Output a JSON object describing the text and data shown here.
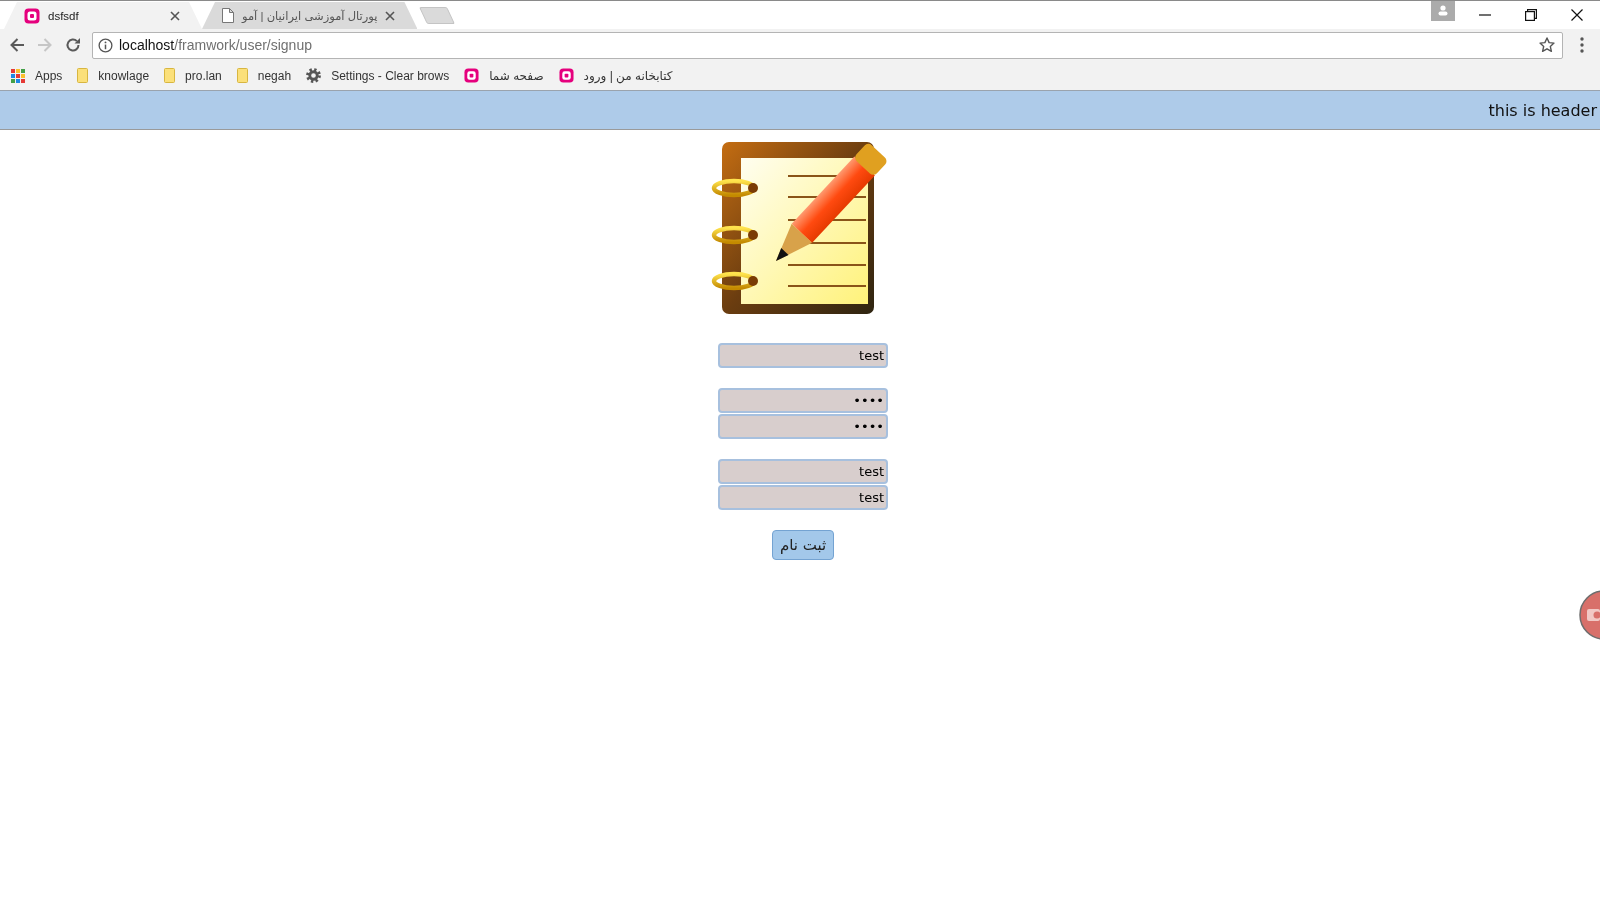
{
  "browser": {
    "tabs": [
      {
        "title": "dsfsdf",
        "kind": "logo",
        "selected": true
      },
      {
        "title": "پورتال آموزشی ایرانیان | آمو",
        "kind": "document",
        "selected": false
      }
    ],
    "navigation": [
      {
        "kind": "back",
        "disabled": false
      },
      {
        "kind": "forward",
        "disabled": true
      },
      {
        "kind": "reload",
        "disabled": false
      }
    ],
    "address": {
      "host": "localhost",
      "path": "/framwork/user/signup"
    },
    "bookmarks": [
      {
        "label": "Apps",
        "kind": "apps"
      },
      {
        "label": "knowlage",
        "kind": "folder"
      },
      {
        "label": "pro.lan",
        "kind": "folder"
      },
      {
        "label": "negah",
        "kind": "folder"
      },
      {
        "label": "Settings - Clear brows",
        "kind": "settings"
      },
      {
        "label": "صفحه شما",
        "kind": "logo"
      },
      {
        "label": "کتابخانه من | ورود",
        "kind": "logo"
      }
    ]
  },
  "page": {
    "header": "this is header",
    "field_groups": [
      {
        "fields": [
          {
            "value": "test"
          }
        ]
      },
      {
        "fields": [
          {
            "value": "••••"
          },
          {
            "value": "••••"
          }
        ]
      },
      {
        "fields": [
          {
            "value": "test"
          },
          {
            "value": "test"
          }
        ]
      }
    ],
    "submit": "ثبت نام"
  }
}
